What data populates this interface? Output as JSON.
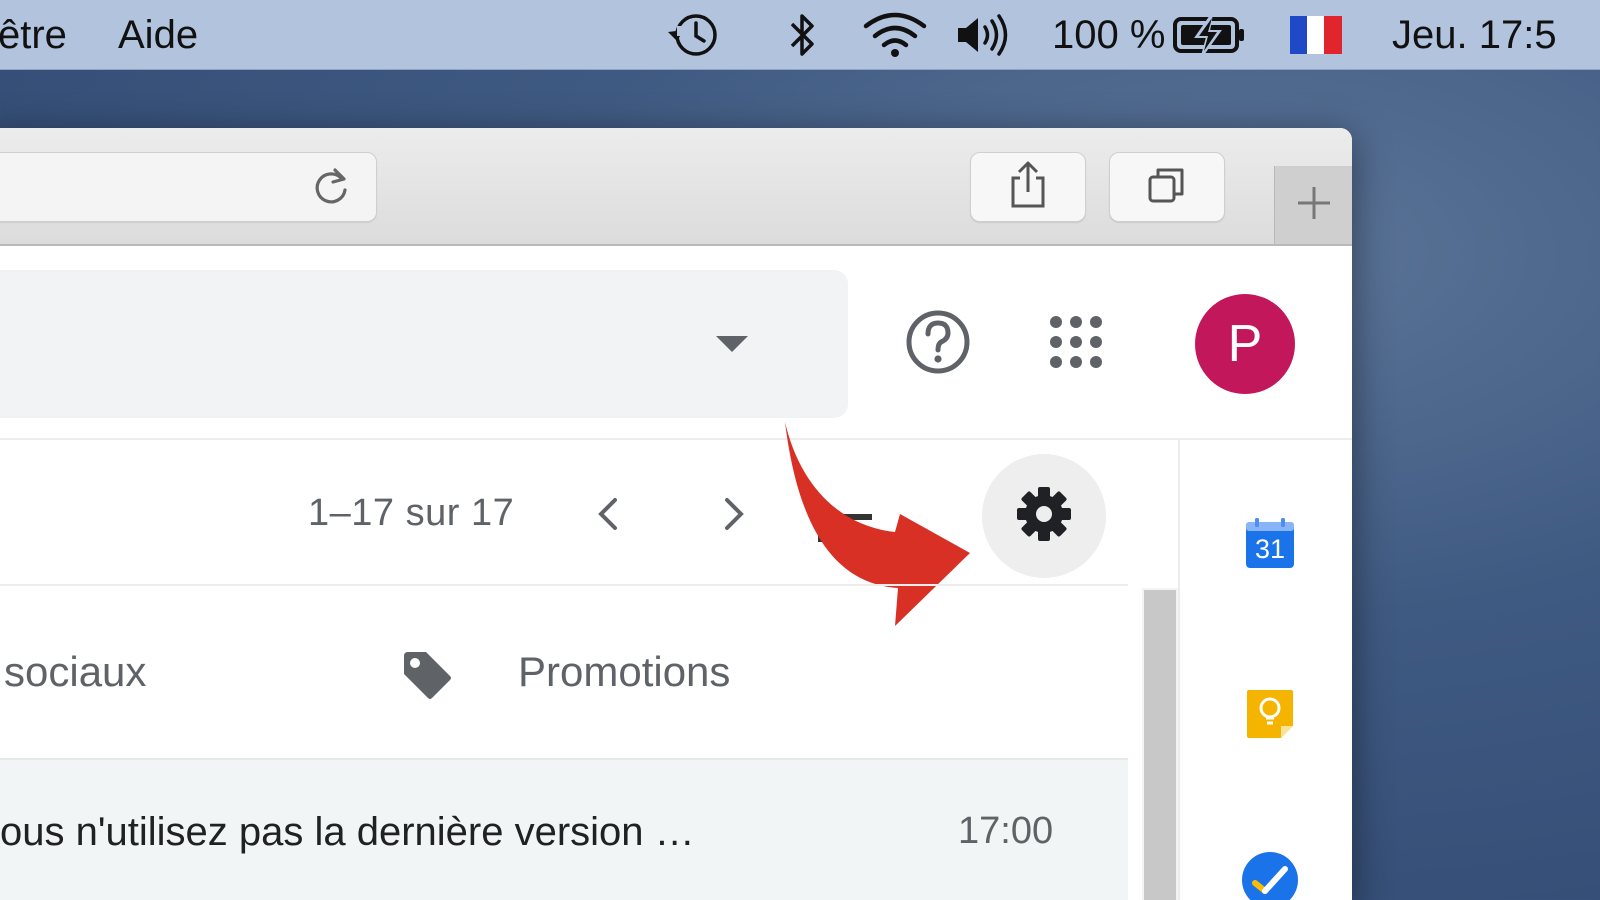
{
  "menubar": {
    "menus": [
      "être",
      "Aide"
    ],
    "battery_percent": "100 %",
    "clock": "Jeu. 17:5",
    "icons": [
      "time-machine-icon",
      "bluetooth-icon",
      "wifi-icon",
      "volume-icon",
      "battery-charging-icon",
      "french-flag-icon"
    ]
  },
  "browser": {
    "toolbar_icons": [
      "reload-icon",
      "share-icon",
      "tabs-overview-icon",
      "new-tab-icon"
    ]
  },
  "gmail": {
    "header": {
      "avatar_letter": "P",
      "avatar_color": "#c2185b",
      "icons": [
        "search-options-icon",
        "help-icon",
        "apps-grid-icon"
      ]
    },
    "toolbar": {
      "pagination": "1–17 sur 17",
      "icons": [
        "chevron-left-icon",
        "chevron-right-icon",
        "settings-gear-icon"
      ]
    },
    "tabs": [
      {
        "label": "sociaux",
        "icon": "people-icon"
      },
      {
        "label": "Promotions",
        "icon": "tag-icon"
      }
    ],
    "emails": [
      {
        "subject": "ous n'utilisez pas la dernière version …",
        "time": "17:00"
      }
    ],
    "side_panel": {
      "calendar_day": "31",
      "icons": [
        "calendar-icon",
        "keep-icon",
        "tasks-icon"
      ],
      "colors": {
        "calendar": "#1a73e8",
        "keep": "#f4b400",
        "tasks": "#1a73e8"
      }
    },
    "annotation_arrow_color": "#d93025"
  }
}
